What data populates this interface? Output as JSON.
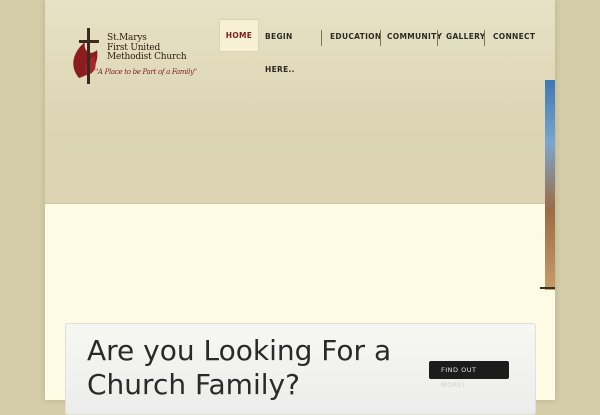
{
  "logo": {
    "name_lines": [
      "St.Marys",
      "First United",
      "Methodist Church"
    ],
    "tagline": "\"A Place to be Part of a Family\""
  },
  "nav": {
    "items": [
      {
        "label": "HOME",
        "active": true
      },
      {
        "label": "BEGIN"
      },
      {
        "label": "HERE.."
      },
      {
        "label": "EDUCATION"
      },
      {
        "label": "COMMUNITY"
      },
      {
        "label": "GALLERY"
      },
      {
        "label": "CONNECT"
      }
    ]
  },
  "callout": {
    "title": "Are you Looking For a Church Family?",
    "cta_line1": "FIND OUT",
    "cta_line2": "MORE!"
  },
  "colors": {
    "background": "#d5cda7",
    "page": "#fefbe4",
    "header": "#e1dbbd",
    "active_nav": "#7a1e1e",
    "logo_red": "#8b1d1d",
    "cta": "#1c1c1c"
  },
  "icons": [
    "cross-flame-icon"
  ]
}
